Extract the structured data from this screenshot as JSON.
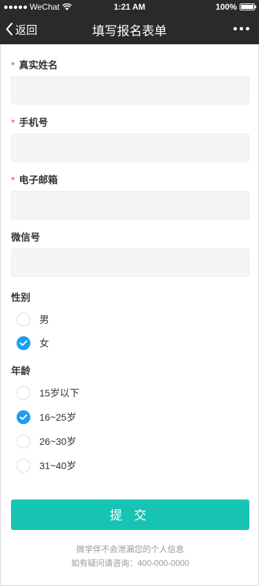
{
  "status_bar": {
    "carrier": "WeChat",
    "time": "1:21 AM",
    "battery": "100%",
    "battery_level": 1.0
  },
  "nav": {
    "back_label": "返回",
    "title": "填写报名表单"
  },
  "form": {
    "fields": [
      {
        "label": "真实姓名",
        "required": true,
        "value": "",
        "placeholder": ""
      },
      {
        "label": "手机号",
        "required": true,
        "value": "",
        "placeholder": ""
      },
      {
        "label": "电子邮箱",
        "required": true,
        "value": "",
        "placeholder": ""
      },
      {
        "label": "微信号",
        "required": false,
        "value": "",
        "placeholder": ""
      }
    ],
    "required_mark": "*",
    "gender": {
      "label": "性别",
      "options": [
        {
          "label": "男",
          "checked": false
        },
        {
          "label": "女",
          "checked": true
        }
      ]
    },
    "age": {
      "label": "年龄",
      "options": [
        {
          "label": "15岁以下",
          "checked": false
        },
        {
          "label": "16~25岁",
          "checked": true
        },
        {
          "label": "26~30岁",
          "checked": false
        },
        {
          "label": "31~40岁",
          "checked": false
        }
      ]
    },
    "submit_label": "提 交"
  },
  "footer": {
    "privacy_note": "微学伴不会泄漏您的个人信息",
    "contact_note": "如有疑问请咨询：400-000-0000"
  },
  "colors": {
    "nav_bg": "#2a2a2a",
    "accent_radio": "#1aa0f0",
    "submit_bg": "#17c4b3",
    "required": "#e64340"
  },
  "icons": {
    "back": "chevron-left-icon",
    "more": "more-dots-icon",
    "check": "check-icon",
    "wifi": "wifi-icon",
    "battery": "battery-icon"
  }
}
